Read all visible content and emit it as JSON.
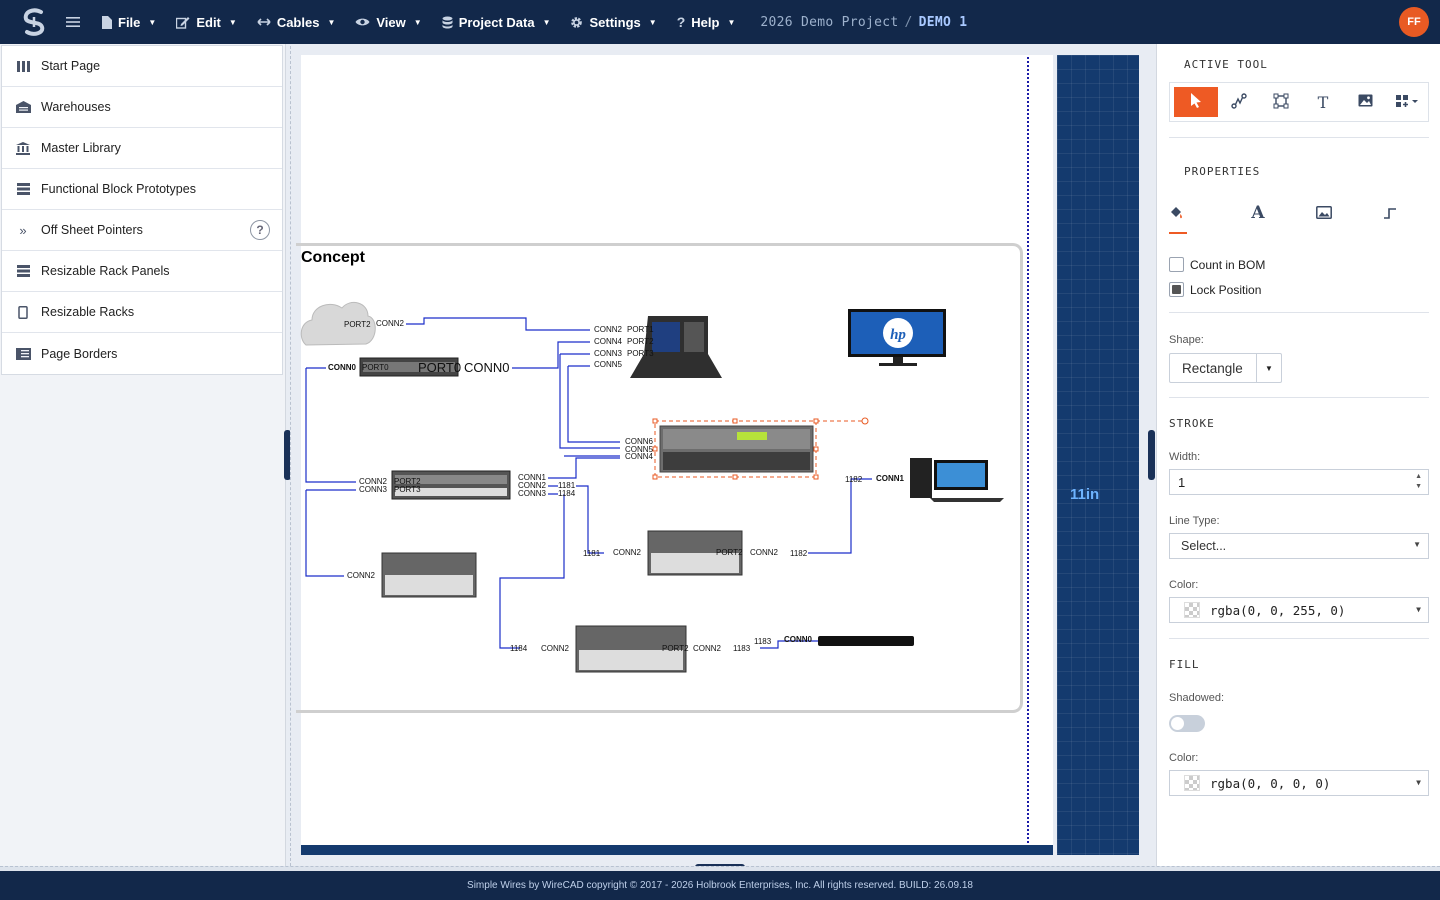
{
  "app": {
    "project": "2026 Demo Project",
    "separator": "/",
    "page": "DEMO 1",
    "avatar_initials": "FF",
    "accent_color": "#ee5a24",
    "topbar_color": "#12284a"
  },
  "menu": [
    {
      "label": "File",
      "icon": "file-icon"
    },
    {
      "label": "Edit",
      "icon": "edit-icon"
    },
    {
      "label": "Cables",
      "icon": "cables-icon"
    },
    {
      "label": "View",
      "icon": "eye-icon"
    },
    {
      "label": "Project Data",
      "icon": "database-icon"
    },
    {
      "label": "Settings",
      "icon": "gear-icon"
    },
    {
      "label": "Help",
      "icon": "question-icon"
    }
  ],
  "sidebar": {
    "items": [
      {
        "label": "Start Page",
        "icon": "columns-icon"
      },
      {
        "label": "Warehouses",
        "icon": "warehouse-icon"
      },
      {
        "label": "Master Library",
        "icon": "library-icon"
      },
      {
        "label": "Functional Block Prototypes",
        "icon": "blocks-icon"
      },
      {
        "label": "Off Sheet Pointers",
        "icon": "double-chevron-icon",
        "help": "?"
      },
      {
        "label": "Resizable Rack Panels",
        "icon": "rack-panels-icon"
      },
      {
        "label": "Resizable Racks",
        "icon": "rack-icon"
      },
      {
        "label": "Page Borders",
        "icon": "page-border-icon"
      }
    ]
  },
  "canvas": {
    "section_title": "Concept",
    "ruler_label": "11in",
    "labels": {
      "port2": "PORT2",
      "port3": "PORT3",
      "port0": "PORT0",
      "port1": "PORT1",
      "conn0": "CONN0",
      "conn1": "CONN1",
      "conn2": "CONN2",
      "conn3": "CONN3",
      "conn4": "CONN4",
      "conn5": "CONN5",
      "conn6": "CONN6",
      "n1181": "1181",
      "n1182": "1182",
      "n1183": "1183",
      "n1184": "1184",
      "hp": "hp"
    }
  },
  "right_panel": {
    "active_tool_title": "ACTIVE TOOL",
    "properties_title": "PROPERTIES",
    "count_in_bom": "Count in BOM",
    "lock_position": "Lock Position",
    "shape_label": "Shape:",
    "shape_value": "Rectangle",
    "stroke_title": "STROKE",
    "width_label": "Width:",
    "width_value": "1",
    "line_type_label": "Line Type:",
    "line_type_placeholder": "Select...",
    "stroke_color_label": "Color:",
    "stroke_color_value": "rgba(0, 0, 255, 0)",
    "fill_title": "FILL",
    "shadowed_label": "Shadowed:",
    "fill_color_label": "Color:",
    "fill_color_value": "rgba(0, 0, 0, 0)",
    "count_in_bom_checked": false,
    "lock_position_checked": true,
    "shadowed_on": false
  },
  "footer": {
    "text": "Simple Wires by WireCAD copyright © 2017 - 2026 Holbrook Enterprises, Inc. All rights reserved. BUILD: 26.09.18"
  }
}
